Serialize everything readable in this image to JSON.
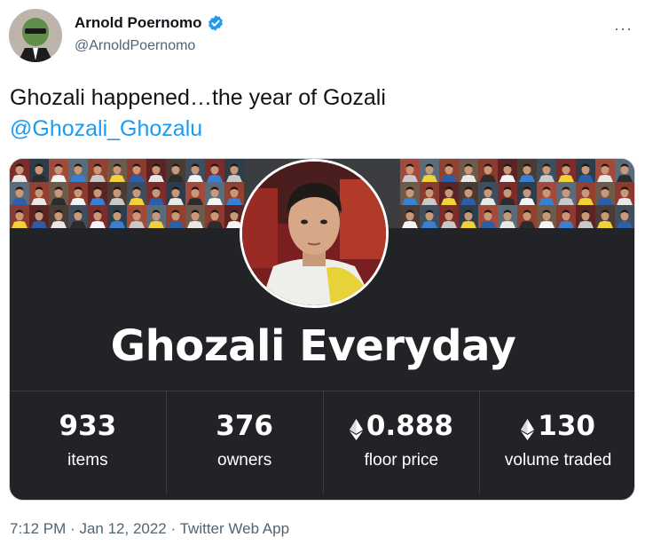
{
  "author": {
    "display_name": "Arnold Poernomo",
    "handle": "@ArnoldPoernomo",
    "verified": true,
    "verified_color": "#1d9bf0"
  },
  "menu": {
    "more_label": "···"
  },
  "tweet": {
    "text": "Ghozali happened…the year of Gozali",
    "mention": "@Ghozali_Ghozalu"
  },
  "card": {
    "collection_title": "Ghozali Everyday",
    "stats": [
      {
        "value": "933",
        "label": "items",
        "icon": ""
      },
      {
        "value": "376",
        "label": "owners",
        "icon": ""
      },
      {
        "value": "0.888",
        "label": "floor price",
        "icon": "ethereum-icon"
      },
      {
        "value": "130",
        "label": "volume traded",
        "icon": "ethereum-icon"
      }
    ]
  },
  "footer": {
    "time": "7:12 PM",
    "date": "Jan 12, 2022",
    "source": "Twitter Web App",
    "separator": "·"
  },
  "colors": {
    "link": "#1d9bf0",
    "card_bg": "#212327",
    "muted_text": "#536471"
  }
}
